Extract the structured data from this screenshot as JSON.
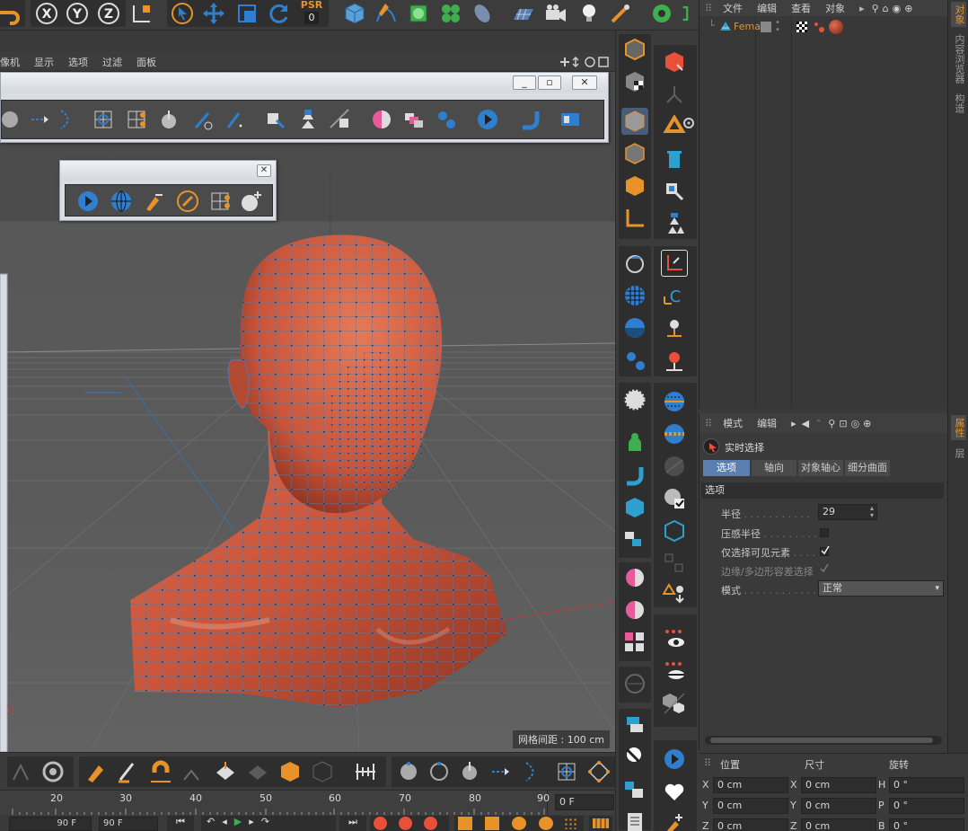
{
  "viewport": {
    "menu": [
      "像机",
      "显示",
      "选项",
      "过滤",
      "面板"
    ],
    "grid_spacing": "网格间距 : 100 cm"
  },
  "object_manager": {
    "menu": [
      "文件",
      "编辑",
      "查看",
      "对象"
    ],
    "object_name": "Fema"
  },
  "attribute_manager": {
    "menu": [
      "模式",
      "编辑"
    ],
    "tool_name": "实时选择",
    "tabs": [
      "选项",
      "轴向",
      "对象轴心",
      "细分曲面"
    ],
    "active_tab": "选项",
    "section_title": "选项",
    "fields": {
      "radius_label": "半径",
      "radius_value": "29",
      "pressure_label": "压感半径",
      "visible_only_label": "仅选择可见元素",
      "edge_tolerance_label": "边缘/多边形容差选择",
      "mode_label": "模式",
      "mode_value": "正常"
    }
  },
  "side_tabs": {
    "objects": "对象",
    "content_browser": "内容浏览器",
    "structure": "构造",
    "attributes": "属性",
    "layers": "层"
  },
  "coordinates": {
    "headers": [
      "位置",
      "尺寸",
      "旋转"
    ],
    "rows": [
      {
        "pos_axis": "X",
        "pos": "0 cm",
        "size_axis": "X",
        "size": "0 cm",
        "rot_axis": "H",
        "rot": "0 °"
      },
      {
        "pos_axis": "Y",
        "pos": "0 cm",
        "size_axis": "Y",
        "size": "0 cm",
        "rot_axis": "P",
        "rot": "0 °"
      },
      {
        "pos_axis": "Z",
        "pos": "0 cm",
        "size_axis": "Z",
        "size": "0 cm",
        "rot_axis": "B",
        "rot": "0 °"
      }
    ]
  },
  "timeline": {
    "ticks": [
      "20",
      "30",
      "40",
      "50",
      "60",
      "70",
      "80",
      "90"
    ],
    "current_frame": "0 F",
    "end_frame_left": "90 F",
    "end_frame_right": "90 F"
  },
  "toolbar": {
    "axis_x": "X",
    "axis_y": "Y",
    "axis_z": "Z",
    "psr_label": "PSR",
    "psr_value": "0"
  },
  "colors": {
    "accent_orange": "#e8922a",
    "accent_blue": "#2f7fd0",
    "model_skin": "#c8553a",
    "active_tab": "#5a7fb0"
  }
}
